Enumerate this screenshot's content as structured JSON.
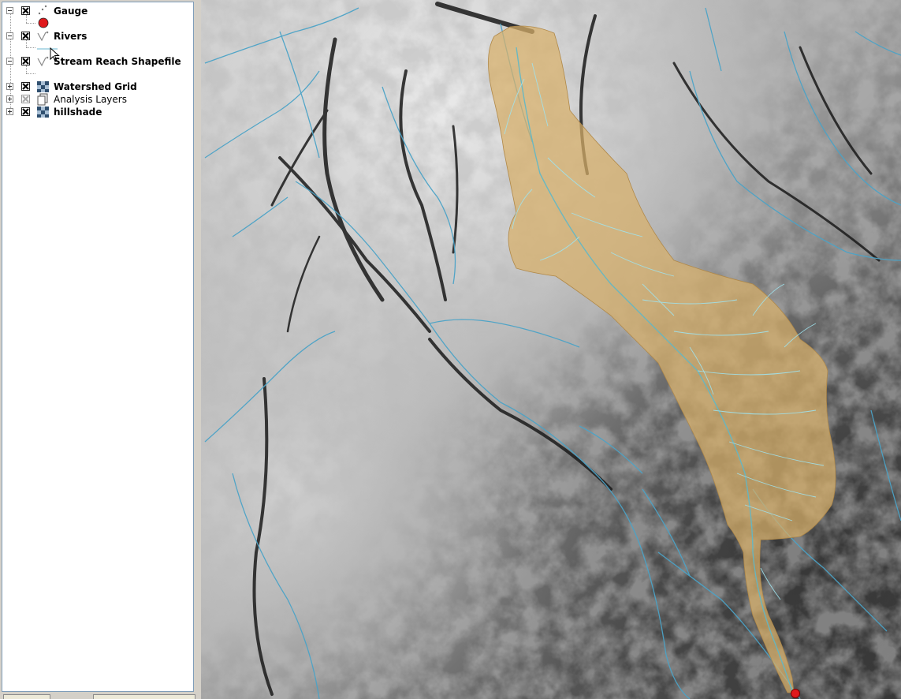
{
  "layers_panel": {
    "layers": [
      {
        "name": "Gauge",
        "bold": true,
        "checked": true,
        "expanded": true,
        "icon": "point-layer-icon"
      },
      {
        "name": "Rivers",
        "bold": true,
        "checked": true,
        "expanded": true,
        "icon": "line-layer-icon"
      },
      {
        "name": "Stream Reach Shapefile",
        "bold": true,
        "checked": true,
        "expanded": true,
        "icon": "line-layer-icon"
      },
      {
        "name": "Watershed Grid",
        "bold": true,
        "checked": true,
        "expanded": false,
        "icon": "raster-layer-icon"
      },
      {
        "name": "Analysis Layers",
        "bold": false,
        "checked": true,
        "expanded": false,
        "icon": "group-layer-icon"
      },
      {
        "name": "hillshade",
        "bold": true,
        "checked": true,
        "expanded": false,
        "icon": "raster-layer-icon"
      }
    ]
  },
  "colors": {
    "gauge_symbol": "#e0191c",
    "river_line": "#4ba3c7",
    "watershed_fill": "#d8b06a",
    "stream_reach": "#9fe3ee",
    "panel_bg": "#ffffff",
    "frame_bg": "#d4d0c8"
  },
  "map": {
    "icons": [
      "hillshade-raster",
      "watershed-polygon",
      "gauge-point"
    ]
  }
}
